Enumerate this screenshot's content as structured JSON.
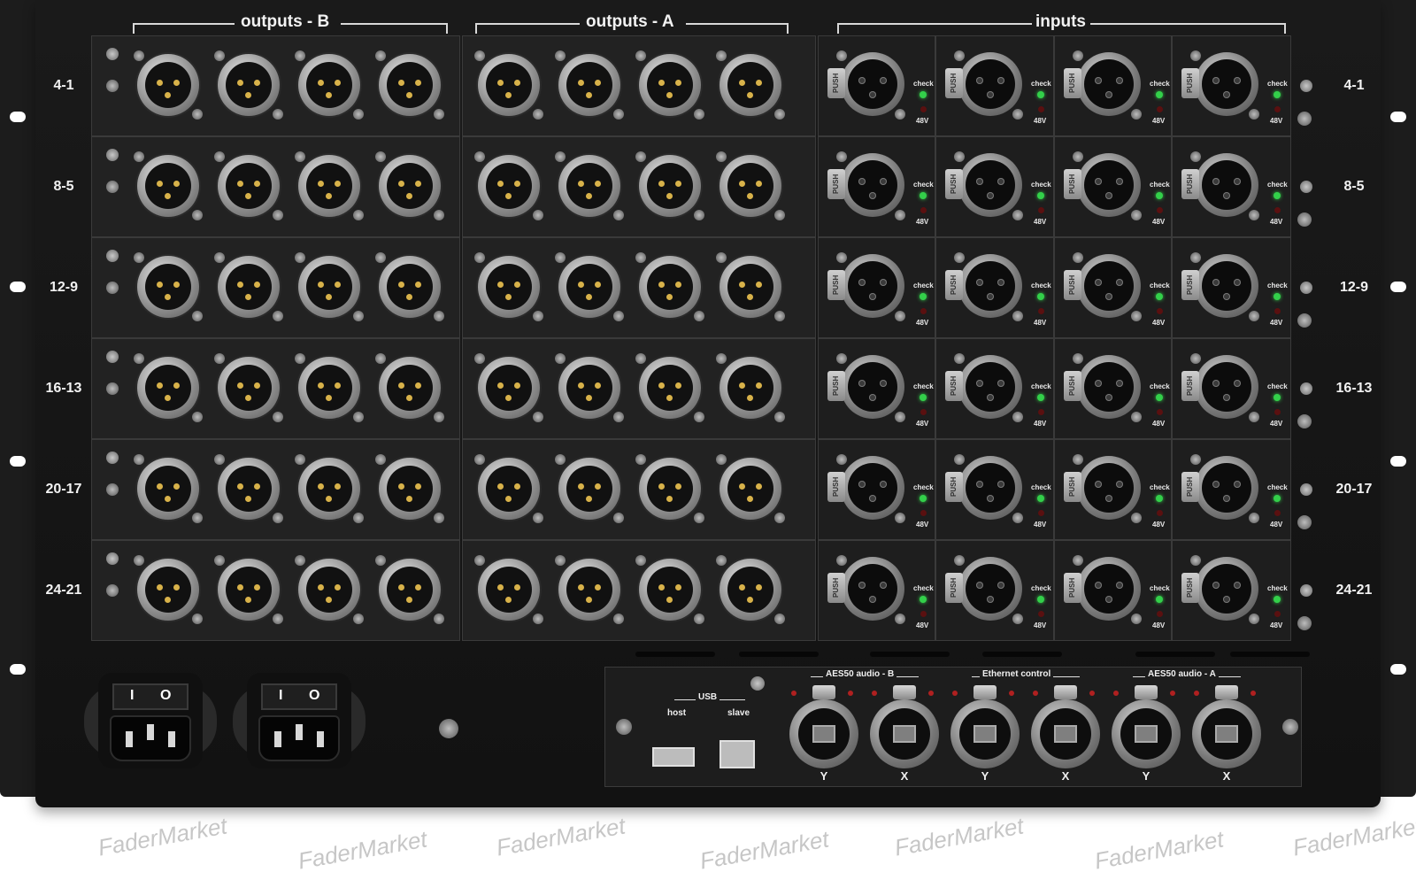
{
  "sections": {
    "outputs_b": "outputs - B",
    "outputs_a": "outputs - A",
    "inputs": "inputs"
  },
  "row_labels": [
    "4-1",
    "8-5",
    "12-9",
    "16-13",
    "20-17",
    "24-21"
  ],
  "input_labels": {
    "push": "PUSH",
    "check": "check",
    "phantom": "48V"
  },
  "io_panel": {
    "usb_label": "USB",
    "host_label": "host",
    "slave_label": "slave",
    "aes50_b": "AES50 audio - B",
    "ethernet_control": "Ethernet control",
    "aes50_a": "AES50 audio - A",
    "port_labels": [
      "Y",
      "X",
      "Y",
      "X",
      "Y",
      "X"
    ]
  },
  "power": {
    "switch_off": "O",
    "switch_on": "I"
  },
  "watermark": "FaderMarket",
  "colors": {
    "chassis": "#161616",
    "check_led": "#33d04a",
    "phantom_led": "#5a1010",
    "aes_led": "#b02020"
  }
}
